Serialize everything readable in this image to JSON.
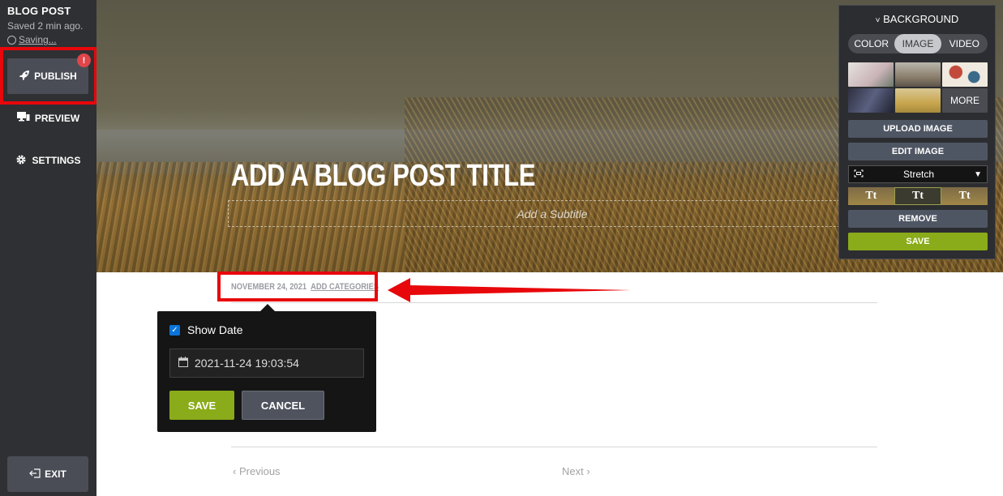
{
  "sidebar": {
    "title": "BLOG POST",
    "saved": "Saved 2 min ago.",
    "saving": "Saving...",
    "badge": "!",
    "publish": "PUBLISH",
    "preview": "PREVIEW",
    "settings": "SETTINGS",
    "exit": "EXIT"
  },
  "hero": {
    "title": "ADD A BLOG POST TITLE",
    "subtitle_placeholder": "Add a Subtitle"
  },
  "meta": {
    "date": "NOVEMBER 24, 2021",
    "categories": "ADD CATEGORIES"
  },
  "date_popup": {
    "show_date_label": "Show Date",
    "show_date_checked": true,
    "date_value": "2021-11-24 19:03:54",
    "save": "SAVE",
    "cancel": "CANCEL"
  },
  "nav": {
    "prev": "Previous",
    "next": "Next"
  },
  "background_panel": {
    "heading": "BACKGROUND",
    "tabs": [
      "COLOR",
      "IMAGE",
      "VIDEO"
    ],
    "active_tab": "IMAGE",
    "more": "MORE",
    "upload": "UPLOAD IMAGE",
    "edit": "EDIT IMAGE",
    "fit_mode": "Stretch",
    "text_style_sample": "Tt",
    "remove": "REMOVE",
    "save": "SAVE"
  },
  "colors": {
    "sidebar": "#2f3033",
    "accent_green": "#8aab1a",
    "highlight_red": "#e8070b"
  }
}
